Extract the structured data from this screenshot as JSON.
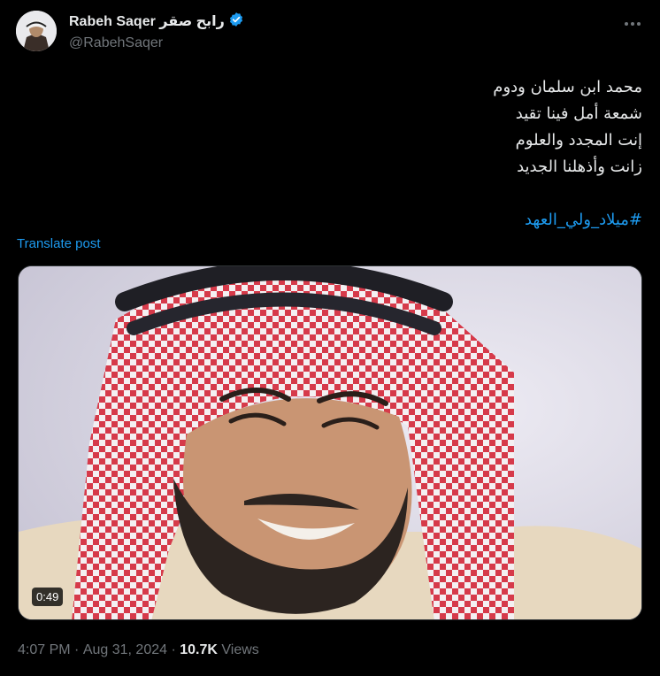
{
  "author": {
    "display_name": "Rabeh Saqer رابح صقر",
    "handle": "@RabehSaqer",
    "verified": true
  },
  "tweet": {
    "lines": [
      "محمد ابن سلمان ودوم",
      "شمعة أمل فينا تقيد",
      "إنت المجدد والعلوم",
      "زانت وأذهلنا الجديد"
    ],
    "hashtag": "#ميلاد_ولي_العهد"
  },
  "translate_label": "Translate post",
  "media": {
    "duration": "0:49"
  },
  "meta": {
    "time": "4:07 PM",
    "separator1": " · ",
    "date": "Aug 31, 2024",
    "separator2": " · ",
    "views_count": "10.7K",
    "views_label": " Views"
  },
  "colors": {
    "background": "#000000",
    "text": "#e7e9ea",
    "secondary": "#71767b",
    "accent": "#1d9bf0"
  },
  "icons": [
    "avatar",
    "verified-badge-icon",
    "more-options-icon",
    "video-thumbnail"
  ]
}
